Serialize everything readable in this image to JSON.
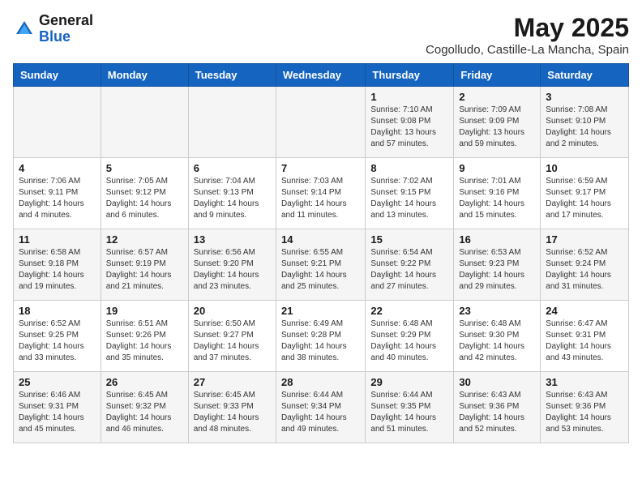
{
  "logo": {
    "general": "General",
    "blue": "Blue"
  },
  "title": "May 2025",
  "location": "Cogolludo, Castille-La Mancha, Spain",
  "headers": [
    "Sunday",
    "Monday",
    "Tuesday",
    "Wednesday",
    "Thursday",
    "Friday",
    "Saturday"
  ],
  "weeks": [
    [
      {
        "day": "",
        "info": ""
      },
      {
        "day": "",
        "info": ""
      },
      {
        "day": "",
        "info": ""
      },
      {
        "day": "",
        "info": ""
      },
      {
        "day": "1",
        "info": "Sunrise: 7:10 AM\nSunset: 9:08 PM\nDaylight: 13 hours\nand 57 minutes."
      },
      {
        "day": "2",
        "info": "Sunrise: 7:09 AM\nSunset: 9:09 PM\nDaylight: 13 hours\nand 59 minutes."
      },
      {
        "day": "3",
        "info": "Sunrise: 7:08 AM\nSunset: 9:10 PM\nDaylight: 14 hours\nand 2 minutes."
      }
    ],
    [
      {
        "day": "4",
        "info": "Sunrise: 7:06 AM\nSunset: 9:11 PM\nDaylight: 14 hours\nand 4 minutes."
      },
      {
        "day": "5",
        "info": "Sunrise: 7:05 AM\nSunset: 9:12 PM\nDaylight: 14 hours\nand 6 minutes."
      },
      {
        "day": "6",
        "info": "Sunrise: 7:04 AM\nSunset: 9:13 PM\nDaylight: 14 hours\nand 9 minutes."
      },
      {
        "day": "7",
        "info": "Sunrise: 7:03 AM\nSunset: 9:14 PM\nDaylight: 14 hours\nand 11 minutes."
      },
      {
        "day": "8",
        "info": "Sunrise: 7:02 AM\nSunset: 9:15 PM\nDaylight: 14 hours\nand 13 minutes."
      },
      {
        "day": "9",
        "info": "Sunrise: 7:01 AM\nSunset: 9:16 PM\nDaylight: 14 hours\nand 15 minutes."
      },
      {
        "day": "10",
        "info": "Sunrise: 6:59 AM\nSunset: 9:17 PM\nDaylight: 14 hours\nand 17 minutes."
      }
    ],
    [
      {
        "day": "11",
        "info": "Sunrise: 6:58 AM\nSunset: 9:18 PM\nDaylight: 14 hours\nand 19 minutes."
      },
      {
        "day": "12",
        "info": "Sunrise: 6:57 AM\nSunset: 9:19 PM\nDaylight: 14 hours\nand 21 minutes."
      },
      {
        "day": "13",
        "info": "Sunrise: 6:56 AM\nSunset: 9:20 PM\nDaylight: 14 hours\nand 23 minutes."
      },
      {
        "day": "14",
        "info": "Sunrise: 6:55 AM\nSunset: 9:21 PM\nDaylight: 14 hours\nand 25 minutes."
      },
      {
        "day": "15",
        "info": "Sunrise: 6:54 AM\nSunset: 9:22 PM\nDaylight: 14 hours\nand 27 minutes."
      },
      {
        "day": "16",
        "info": "Sunrise: 6:53 AM\nSunset: 9:23 PM\nDaylight: 14 hours\nand 29 minutes."
      },
      {
        "day": "17",
        "info": "Sunrise: 6:52 AM\nSunset: 9:24 PM\nDaylight: 14 hours\nand 31 minutes."
      }
    ],
    [
      {
        "day": "18",
        "info": "Sunrise: 6:52 AM\nSunset: 9:25 PM\nDaylight: 14 hours\nand 33 minutes."
      },
      {
        "day": "19",
        "info": "Sunrise: 6:51 AM\nSunset: 9:26 PM\nDaylight: 14 hours\nand 35 minutes."
      },
      {
        "day": "20",
        "info": "Sunrise: 6:50 AM\nSunset: 9:27 PM\nDaylight: 14 hours\nand 37 minutes."
      },
      {
        "day": "21",
        "info": "Sunrise: 6:49 AM\nSunset: 9:28 PM\nDaylight: 14 hours\nand 38 minutes."
      },
      {
        "day": "22",
        "info": "Sunrise: 6:48 AM\nSunset: 9:29 PM\nDaylight: 14 hours\nand 40 minutes."
      },
      {
        "day": "23",
        "info": "Sunrise: 6:48 AM\nSunset: 9:30 PM\nDaylight: 14 hours\nand 42 minutes."
      },
      {
        "day": "24",
        "info": "Sunrise: 6:47 AM\nSunset: 9:31 PM\nDaylight: 14 hours\nand 43 minutes."
      }
    ],
    [
      {
        "day": "25",
        "info": "Sunrise: 6:46 AM\nSunset: 9:31 PM\nDaylight: 14 hours\nand 45 minutes."
      },
      {
        "day": "26",
        "info": "Sunrise: 6:45 AM\nSunset: 9:32 PM\nDaylight: 14 hours\nand 46 minutes."
      },
      {
        "day": "27",
        "info": "Sunrise: 6:45 AM\nSunset: 9:33 PM\nDaylight: 14 hours\nand 48 minutes."
      },
      {
        "day": "28",
        "info": "Sunrise: 6:44 AM\nSunset: 9:34 PM\nDaylight: 14 hours\nand 49 minutes."
      },
      {
        "day": "29",
        "info": "Sunrise: 6:44 AM\nSunset: 9:35 PM\nDaylight: 14 hours\nand 51 minutes."
      },
      {
        "day": "30",
        "info": "Sunrise: 6:43 AM\nSunset: 9:36 PM\nDaylight: 14 hours\nand 52 minutes."
      },
      {
        "day": "31",
        "info": "Sunrise: 6:43 AM\nSunset: 9:36 PM\nDaylight: 14 hours\nand 53 minutes."
      }
    ]
  ]
}
